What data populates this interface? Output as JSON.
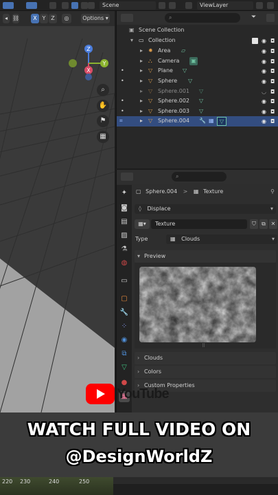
{
  "topbar": {
    "scene_label": "Scene",
    "viewlayer_label": "ViewLayer"
  },
  "viewport": {
    "axis_labels": [
      "X",
      "Y",
      "Z"
    ],
    "options_label": "Options",
    "gizmo": {
      "x": "X",
      "y": "Y",
      "z": "Z"
    }
  },
  "outliner": {
    "root": "Scene Collection",
    "collection": "Collection",
    "items": [
      {
        "name": "Area",
        "icon": "light-icon",
        "color": "#d89a4b"
      },
      {
        "name": "Camera",
        "icon": "camera-icon",
        "color": "#d89a4b"
      },
      {
        "name": "Plane",
        "icon": "mesh-icon",
        "color": "#d89a4b"
      },
      {
        "name": "Sphere",
        "icon": "mesh-icon",
        "color": "#d89a4b"
      },
      {
        "name": "Sphere.001",
        "icon": "mesh-icon",
        "color": "#d89a4b"
      },
      {
        "name": "Sphere.002",
        "icon": "mesh-icon",
        "color": "#d89a4b"
      },
      {
        "name": "Sphere.003",
        "icon": "mesh-icon",
        "color": "#d89a4b"
      },
      {
        "name": "Sphere.004",
        "icon": "mesh-icon",
        "color": "#d89a4b"
      }
    ]
  },
  "properties": {
    "breadcrumb_object": "Sphere.004",
    "breadcrumb_sep": ">",
    "breadcrumb_context": "Texture",
    "modifier": "Displace",
    "texture_name": "Texture",
    "type_label": "Type",
    "type_value": "Clouds",
    "preview_label": "Preview",
    "panels": [
      "Clouds",
      "Colors",
      "Custom Properties"
    ]
  },
  "overlay": {
    "youtube_text": "YouTube",
    "line1": "WATCH FULL VIDEO ON",
    "line2": "@DesignWorldZ"
  },
  "timeline": {
    "ticks": [
      "220",
      "230",
      "240",
      "250"
    ]
  },
  "colors": {
    "accent_blue": "#4772b3",
    "selection": "#334d80",
    "mesh_green": "#6fc2a0",
    "object_orange": "#d89a4b"
  }
}
